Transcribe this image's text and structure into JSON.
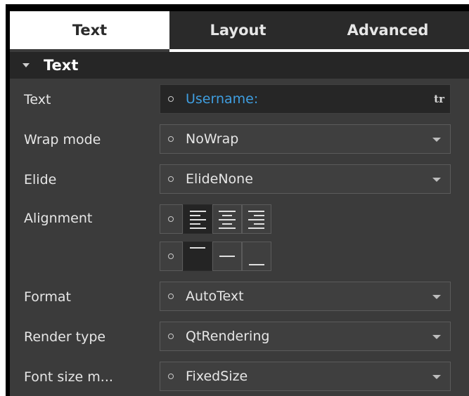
{
  "tabs": [
    {
      "label": "Text",
      "active": true
    },
    {
      "label": "Layout",
      "active": false
    },
    {
      "label": "Advanced",
      "active": false
    }
  ],
  "section": {
    "title": "Text",
    "expanded": true
  },
  "properties": {
    "text": {
      "label": "Text",
      "value": "Username:",
      "translate_badge": "tr"
    },
    "wrap_mode": {
      "label": "Wrap mode",
      "value": "NoWrap"
    },
    "elide": {
      "label": "Elide",
      "value": "ElideNone"
    },
    "alignment": {
      "label": "Alignment",
      "horizontal": {
        "options": [
          "left-align-icon",
          "center-align-icon",
          "right-align-icon"
        ],
        "selected": "left-align-icon"
      },
      "vertical": {
        "options": [
          "top-align-icon",
          "vcenter-align-icon",
          "bottom-align-icon"
        ],
        "selected": "top-align-icon"
      }
    },
    "format": {
      "label": "Format",
      "value": "AutoText"
    },
    "render_type": {
      "label": "Render type",
      "value": "QtRendering"
    },
    "font_size_mode": {
      "label": "Font size m...",
      "value": "FixedSize"
    }
  },
  "colors": {
    "panel_bg": "#3b3b3b",
    "active_tab_bg": "#ffffff",
    "link_text": "#3f9ee0"
  }
}
